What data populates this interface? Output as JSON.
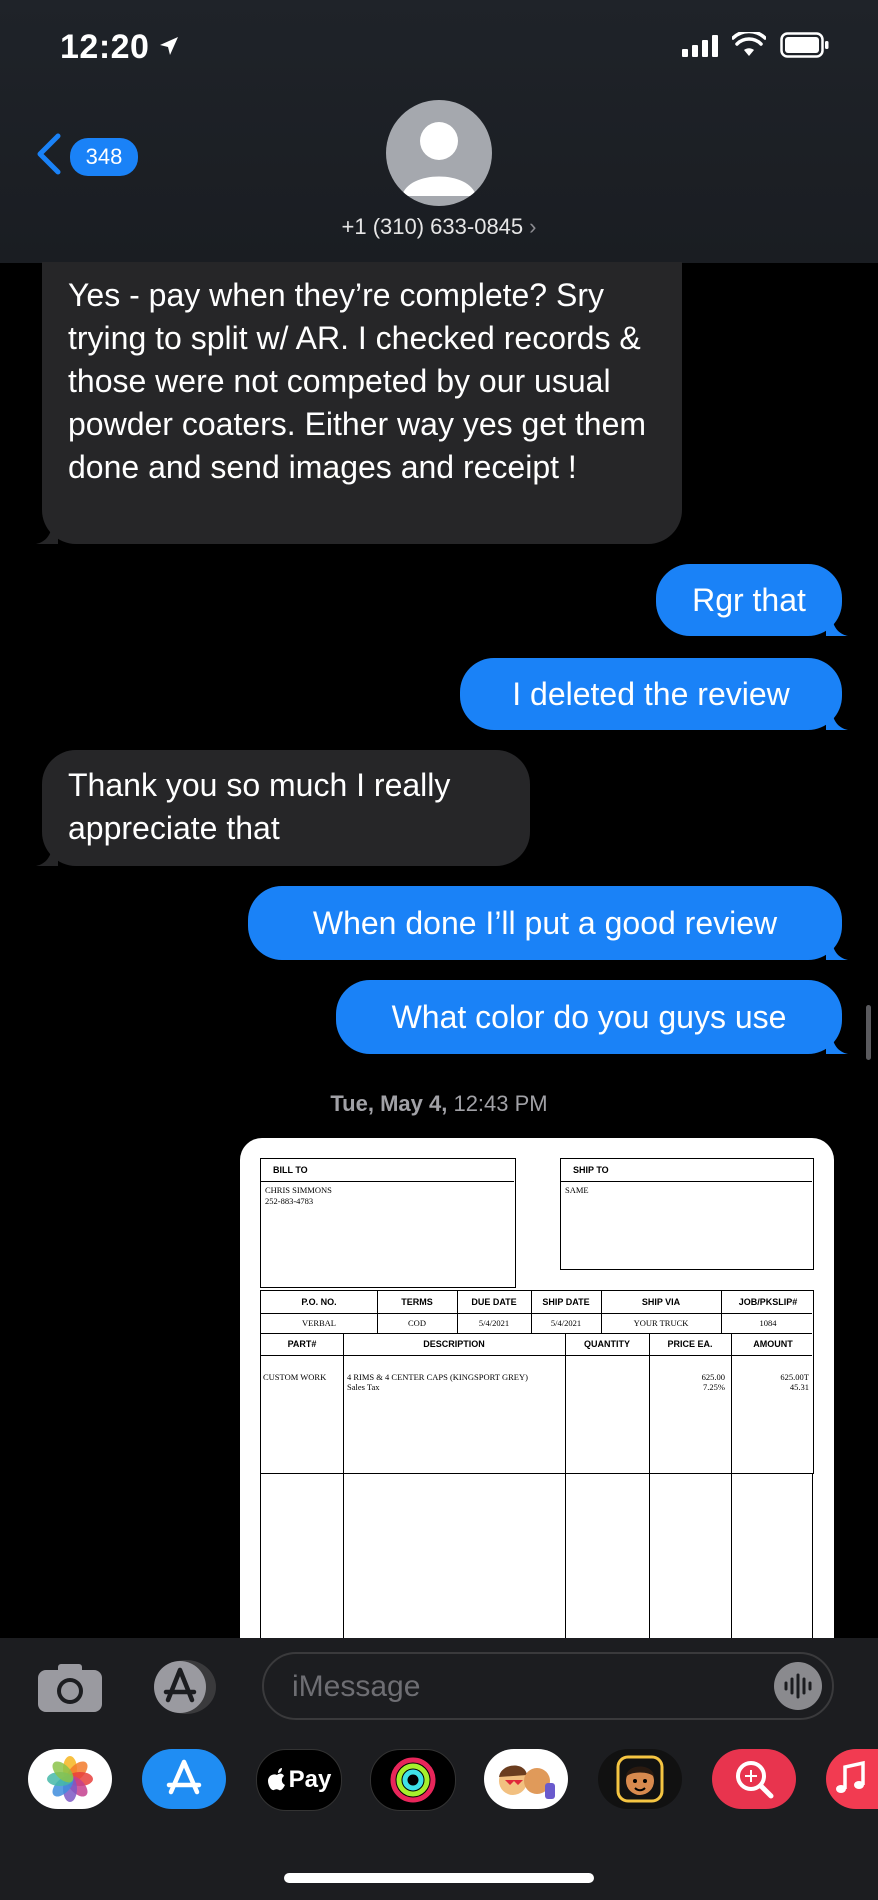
{
  "status_bar": {
    "time": "12:20"
  },
  "header": {
    "back_count": "348",
    "contact": "+1 (310) 633-0845"
  },
  "messages": [
    {
      "dir": "in",
      "text": "Yes - pay when they’re complete? Sry trying to split w/ AR. I checked records & those were not competed by our usual powder coaters. Either way yes get them done and send images and receipt !"
    },
    {
      "dir": "out",
      "text": "Rgr that"
    },
    {
      "dir": "out",
      "text": "I deleted the review"
    },
    {
      "dir": "in",
      "text": "Thank you so much I really appreciate that"
    },
    {
      "dir": "out",
      "text": "When done I’ll put a good review"
    },
    {
      "dir": "out",
      "text": "What color do you guys use"
    }
  ],
  "timestamp": {
    "day": "Tue, May 4,",
    "time": "12:43 PM"
  },
  "invoice": {
    "bill_to_label": "BILL TO",
    "bill_to_name": "CHRIS SIMMONS",
    "bill_to_phone": "252-883-4783",
    "ship_to_label": "SHIP TO",
    "ship_to_value": "SAME",
    "columns1": [
      "P.O. NO.",
      "TERMS",
      "DUE DATE",
      "SHIP DATE",
      "SHIP VIA",
      "JOB/PKSLIP#"
    ],
    "values1": [
      "VERBAL",
      "COD",
      "5/4/2021",
      "5/4/2021",
      "YOUR TRUCK",
      "1084"
    ],
    "columns2": [
      "PART#",
      "DESCRIPTION",
      "QUANTITY",
      "PRICE EA.",
      "AMOUNT"
    ],
    "part": "CUSTOM WORK",
    "desc_line1": "4 RIMS & 4 CENTER CAPS (KINGSPORT GREY)",
    "desc_line2": "Sales Tax",
    "price1": "625.00",
    "price2": "7.25%",
    "amount1": "625.00T",
    "amount2": "45.31"
  },
  "input": {
    "placeholder": "iMessage"
  },
  "apps": [
    "Photos",
    "App Store",
    "Pay",
    "Activity",
    "Memoji Stickers",
    "Memoji",
    "Search Images",
    "Music"
  ],
  "apple_pay_label": "Pay",
  "colors": {
    "outgoing": "#1a82f7",
    "incoming": "#262628",
    "background": "#000000"
  }
}
